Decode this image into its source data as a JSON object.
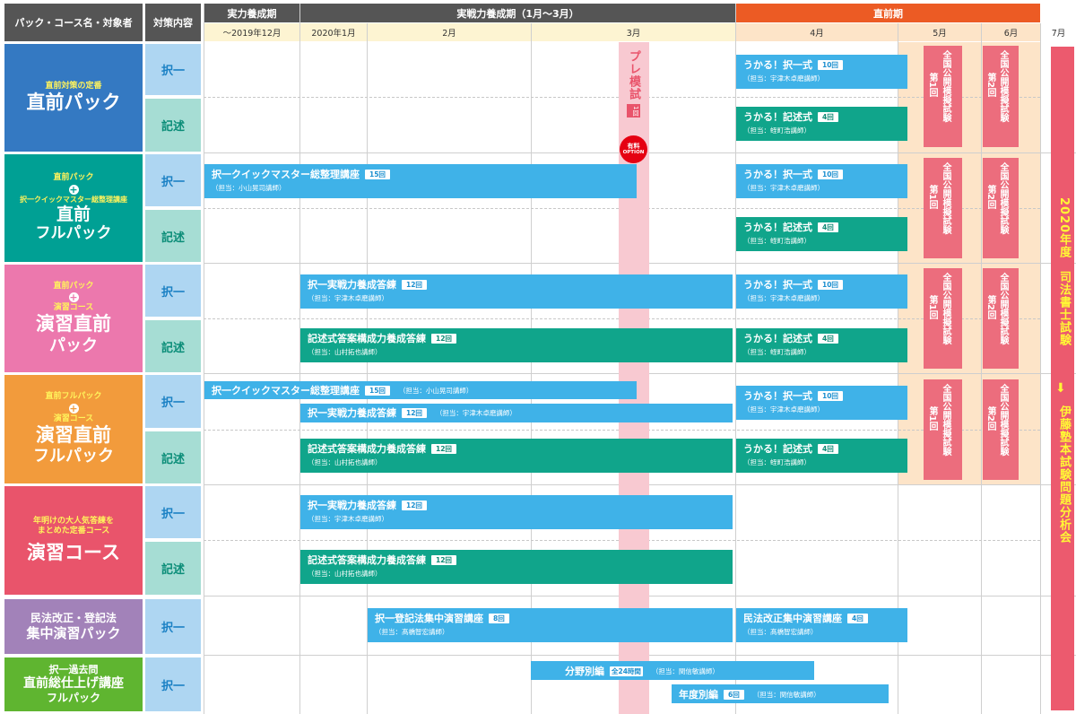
{
  "header": {
    "col_course": "パック・コース名・対象者",
    "col_target": "対策内容",
    "period_1": "実力養成期",
    "period_2": "実戦力養成期（1月～3月）",
    "period_3": "直前期",
    "months": [
      "～2019年12月",
      "2020年1月",
      "2月",
      "3月",
      "4月",
      "5月",
      "6月",
      "7月"
    ]
  },
  "pre_exam": {
    "label": "プレ模試",
    "count": "1回",
    "option_1": "有料",
    "option_2": "OPTION"
  },
  "right_bar": {
    "text_top": "2020年度　司法書士試験",
    "arrow": "⬇",
    "text_bottom": "伊藤塾本試験問題分析会"
  },
  "exam": {
    "round1": "第1回",
    "round2": "第2回",
    "name": "全国公開模擬試験"
  },
  "target_labels": {
    "select": "択一",
    "written": "記述"
  },
  "courses": [
    {
      "sub": [
        "直前対策の定番"
      ],
      "main": [
        "直前パック"
      ],
      "color": "#3479c2"
    },
    {
      "sub": [
        "直前パック",
        "+",
        "択一クイックマスター総整理講座"
      ],
      "main": [
        "直前",
        "フルパック"
      ],
      "color": "#00a094"
    },
    {
      "sub": [
        "直前パック",
        "+",
        "演習コース"
      ],
      "main": [
        "演習直前",
        "パック"
      ],
      "color": "#ec78ad"
    },
    {
      "sub": [
        "直前フルパック",
        "+",
        "演習コース"
      ],
      "main": [
        "演習直前",
        "フルパック"
      ],
      "color": "#f29b3c"
    },
    {
      "sub": [
        "年明けの大人気答練を",
        "まとめた定番コース"
      ],
      "main": [
        "演習コース"
      ],
      "color": "#e9546b"
    },
    {
      "sub": [],
      "main": [
        "民法改正・登記法",
        "集中演習パック"
      ],
      "color": "#a282b9"
    },
    {
      "sub": [],
      "main": [
        "択一過去問",
        "直前総仕上げ講座",
        "フルパック"
      ],
      "color": "#5fb530"
    }
  ],
  "bars": {
    "ukaru_select": {
      "title": "うかる！択一式",
      "badge": "10回",
      "teacher": "（担当：宇津木卓磨講師）"
    },
    "ukaru_written": {
      "title": "うかる！記述式",
      "badge": "4回",
      "teacher": "（担当：蛭町浩講師）"
    },
    "quick_master": {
      "title": "択一クイックマスター総整理講座",
      "badge": "15回",
      "teacher": "（担当：小山晃司講師）"
    },
    "jissen_select": {
      "title": "択一実戦力養成答練",
      "badge": "12回",
      "teacher": "（担当：宇津木卓磨講師）"
    },
    "kijutsu_ans": {
      "title": "記述式答案構成力養成答練",
      "badge": "12回",
      "teacher": "（担当：山村拓也講師）"
    },
    "touki_shuchu": {
      "title": "択一登記法集中演習講座",
      "badge": "8回",
      "teacher": "（担当：髙橋智宏講師）"
    },
    "minpo_kaisei": {
      "title": "民法改正集中演習講座",
      "badge": "4回",
      "teacher": "（担当：髙橋智宏講師）"
    },
    "bunya": {
      "title": "分野別編",
      "badge": "全24時間",
      "teacher": "（担当：関信敏講師）"
    },
    "nendo": {
      "title": "年度別編",
      "badge": "6回",
      "teacher": "（担当：関信敏講師）"
    }
  },
  "colors": {
    "header_dark": "#555555",
    "header_orange": "#ec5b24",
    "bar_blue": "#3fb2e8",
    "bar_green": "#10a58b",
    "exam_pink": "#ec6d7d",
    "pre_exam_strip": "#f8c9d1"
  }
}
